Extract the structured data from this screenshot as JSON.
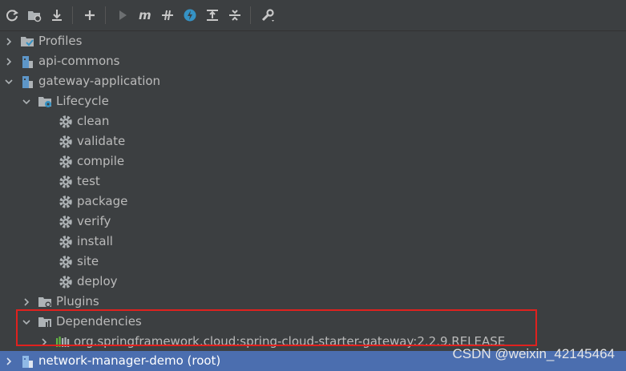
{
  "toolbar": {
    "buttons": [
      {
        "name": "refresh-icon"
      },
      {
        "name": "add-project-icon"
      },
      {
        "name": "download-icon"
      },
      {
        "name": "plus-icon"
      },
      {
        "name": "run-icon"
      },
      {
        "name": "maven-goal-icon"
      },
      {
        "name": "toggle-offline-icon"
      },
      {
        "name": "skip-tests-icon"
      },
      {
        "name": "show-dependencies-icon"
      },
      {
        "name": "collapse-all-icon"
      },
      {
        "name": "settings-wrench-icon"
      }
    ]
  },
  "tree": {
    "profiles": "Profiles",
    "api_commons": "api-commons",
    "gateway_application": "gateway-application",
    "lifecycle": "Lifecycle",
    "goals": [
      "clean",
      "validate",
      "compile",
      "test",
      "package",
      "verify",
      "install",
      "site",
      "deploy"
    ],
    "plugins": "Plugins",
    "dependencies": "Dependencies",
    "dependency_item": "org.springframework.cloud:spring-cloud-starter-gateway:2.2.9.RELEASE",
    "root": "network-manager-demo (root)"
  },
  "watermark": "CSDN @weixin_42145464",
  "colors": {
    "background": "#3c3f41",
    "selection": "#4b6eaf",
    "highlight_box": "#e0211e",
    "folder_blue": "#5d96c8",
    "gear": "#aeb3b6"
  }
}
